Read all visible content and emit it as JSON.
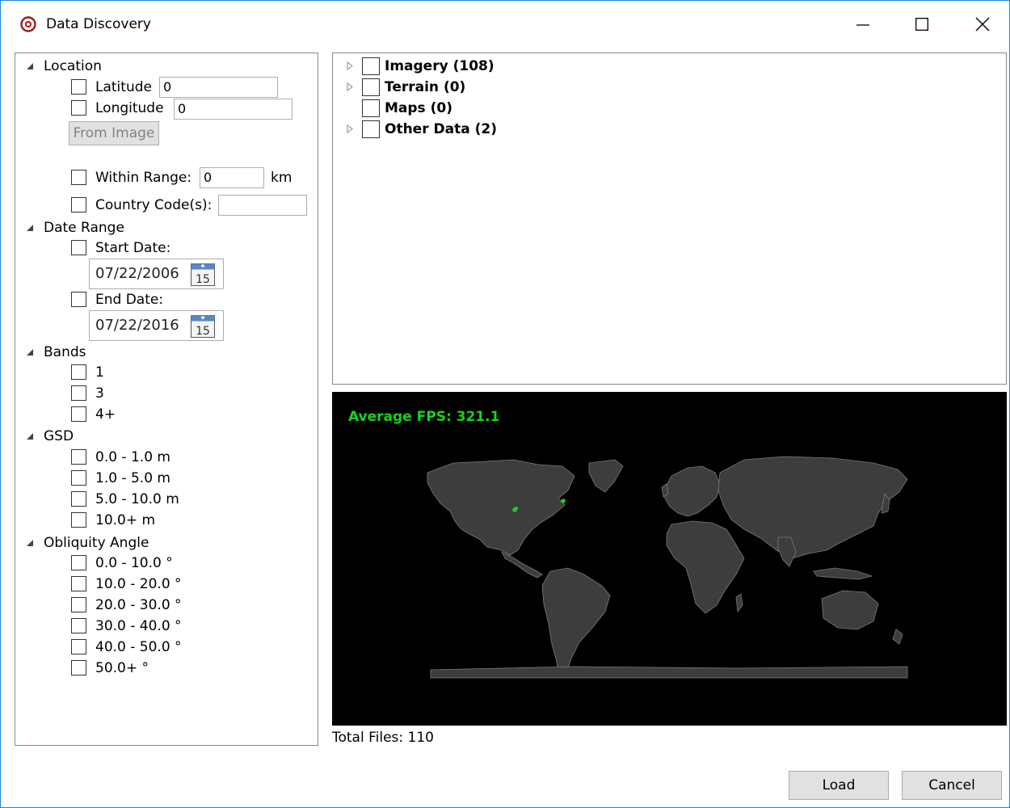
{
  "window": {
    "title": "Data Discovery"
  },
  "filters": {
    "location": {
      "header": "Location",
      "latitude_label": "Latitude",
      "latitude_value": "0",
      "longitude_label": "Longitude",
      "longitude_value": "0",
      "from_image_label": "From Image",
      "within_range_label": "Within Range:",
      "within_range_value": "0",
      "range_unit": "km",
      "country_code_label": "Country Code(s):",
      "country_code_value": ""
    },
    "date_range": {
      "header": "Date Range",
      "start_label": "Start Date:",
      "start_value": "07/22/2006",
      "end_label": "End Date:",
      "end_value": "07/22/2016",
      "calendar_day": "15"
    },
    "bands": {
      "header": "Bands",
      "items": [
        "1",
        "3",
        "4+"
      ]
    },
    "gsd": {
      "header": "GSD",
      "items": [
        "0.0 - 1.0 m",
        "1.0 - 5.0 m",
        "5.0 - 10.0 m",
        "10.0+ m"
      ]
    },
    "obliquity": {
      "header": "Obliquity Angle",
      "items": [
        "0.0 - 10.0 °",
        "10.0 - 20.0 °",
        "20.0 - 30.0 °",
        "30.0 - 40.0 °",
        "40.0 - 50.0 °",
        "50.0+ °"
      ]
    }
  },
  "tree": {
    "items": [
      {
        "label": "Imagery (108)",
        "expandable": true
      },
      {
        "label": "Terrain (0)",
        "expandable": true
      },
      {
        "label": "Maps (0)",
        "expandable": false
      },
      {
        "label": "Other Data (2)",
        "expandable": true
      }
    ]
  },
  "map": {
    "fps_text": "Average FPS: 321.1",
    "land_color": "#3d3d3d",
    "marker_color": "#22cc22"
  },
  "status": {
    "total_files": "Total Files: 110"
  },
  "buttons": {
    "load": "Load",
    "cancel": "Cancel"
  },
  "colors": {
    "accent": "#1883d7",
    "fps_text": "#15d515",
    "map_background": "#000000"
  }
}
